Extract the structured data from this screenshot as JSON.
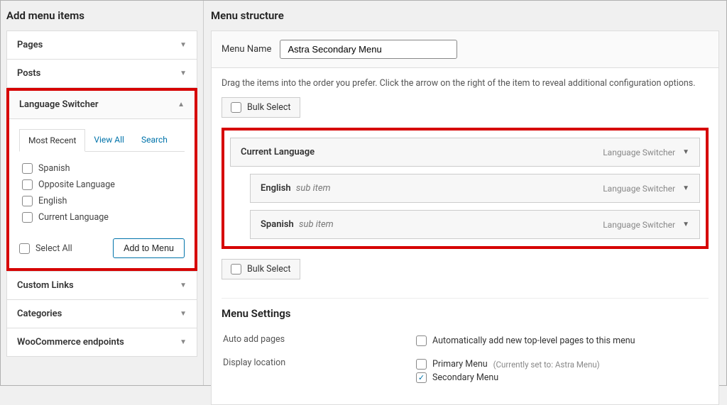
{
  "left": {
    "heading": "Add menu items",
    "sections": {
      "pages": "Pages",
      "posts": "Posts",
      "language_switcher": "Language Switcher",
      "custom_links": "Custom Links",
      "categories": "Categories",
      "woo": "WooCommerce endpoints"
    },
    "tabs": {
      "most_recent": "Most Recent",
      "view_all": "View All",
      "search": "Search"
    },
    "items": {
      "spanish": "Spanish",
      "opposite": "Opposite Language",
      "english": "English",
      "current": "Current Language"
    },
    "select_all": "Select All",
    "add_button": "Add to Menu"
  },
  "right": {
    "heading": "Menu structure",
    "menu_name_label": "Menu Name",
    "menu_name_value": "Astra Secondary Menu",
    "instructions": "Drag the items into the order you prefer. Click the arrow on the right of the item to reveal additional configuration options.",
    "bulk_select": "Bulk Select",
    "items": {
      "current_lang": {
        "title": "Current Language",
        "type": "Language Switcher"
      },
      "english": {
        "title": "English",
        "sub": "sub item",
        "type": "Language Switcher"
      },
      "spanish": {
        "title": "Spanish",
        "sub": "sub item",
        "type": "Language Switcher"
      }
    },
    "settings": {
      "heading": "Menu Settings",
      "auto_add_label": "Auto add pages",
      "auto_add_text": "Automatically add new top-level pages to this menu",
      "display_loc_label": "Display location",
      "primary": "Primary Menu",
      "primary_note": "(Currently set to: Astra Menu)",
      "secondary": "Secondary Menu"
    }
  }
}
